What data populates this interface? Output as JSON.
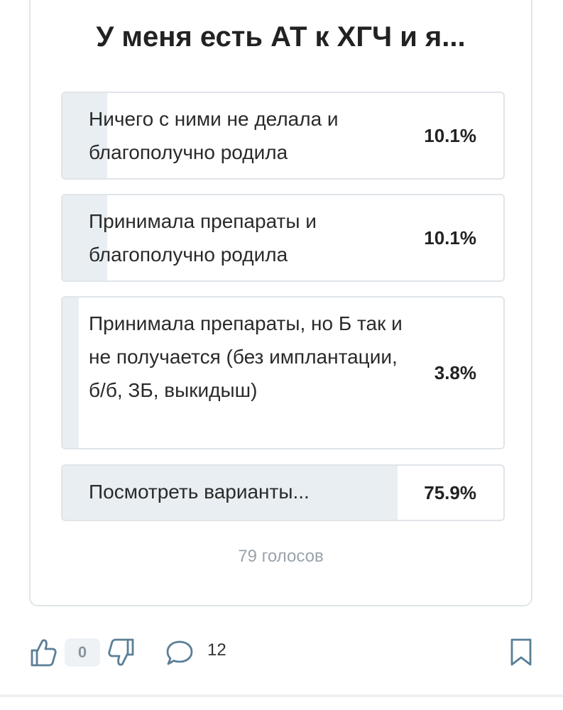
{
  "poll": {
    "title": "У меня есть АТ к ХГЧ и я...",
    "options": [
      {
        "label": "Ничего с ними не делала и благополучно родила",
        "percent_text": "10.1%",
        "percent": 10.1
      },
      {
        "label": "Принимала препараты и благополучно родила",
        "percent_text": "10.1%",
        "percent": 10.1
      },
      {
        "label": "Принимала препараты, но Б так и не получается (без имплантации, б/б, ЗБ, выкидыш)",
        "percent_text": "3.8%",
        "percent": 3.8
      },
      {
        "label": "Посмотреть варианты...",
        "percent_text": "75.9%",
        "percent": 75.9
      }
    ],
    "votes_text": "79 голосов"
  },
  "actions": {
    "like_count": "0",
    "comment_count": "12",
    "icons": [
      "thumbs-up-icon",
      "thumbs-down-icon",
      "comment-icon",
      "bookmark-icon"
    ]
  },
  "colors": {
    "option_fill": "#e8eef2",
    "border": "#dfe6ea",
    "muted_text": "#9aa3ab"
  }
}
